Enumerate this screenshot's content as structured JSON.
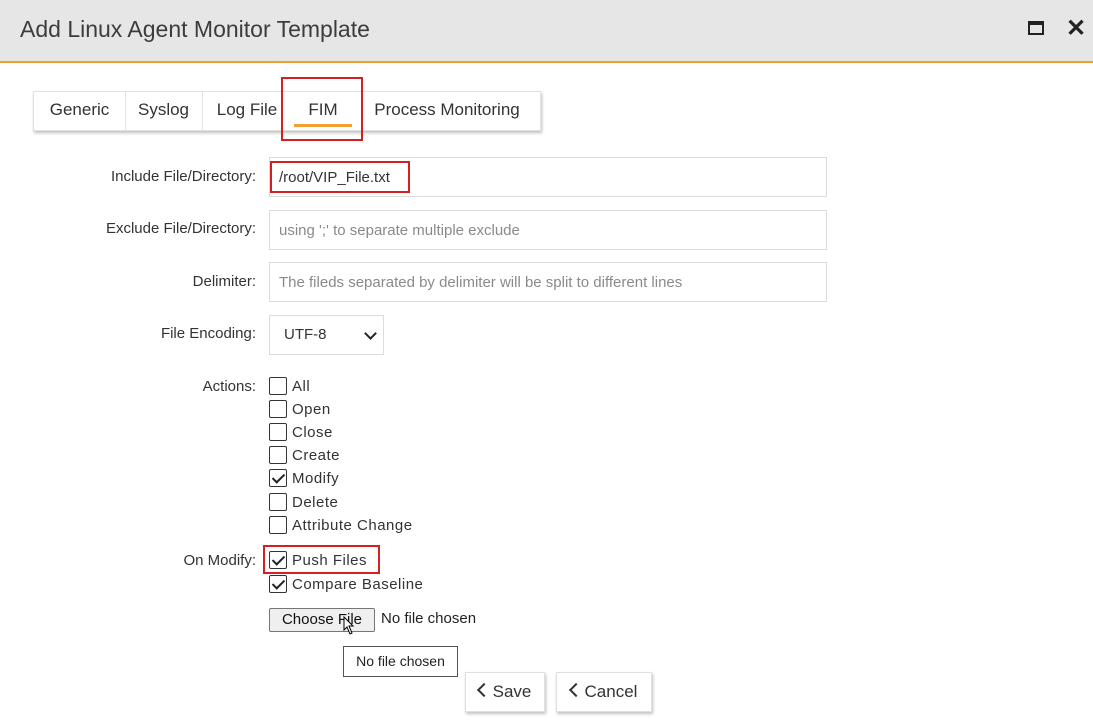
{
  "window": {
    "title": "Add Linux Agent Monitor Template",
    "maximize_icon": "maximize-icon",
    "close_icon": "close-icon",
    "close_glyph": "✕"
  },
  "tabs": [
    {
      "label": "Generic"
    },
    {
      "label": "Syslog"
    },
    {
      "label": "Log File"
    },
    {
      "label": "FIM",
      "active": true
    },
    {
      "label": "Process Monitoring"
    }
  ],
  "form": {
    "include_label": "Include File/Directory:",
    "include_value": "/root/VIP_File.txt",
    "exclude_label": "Exclude File/Directory:",
    "exclude_placeholder": "using ';' to separate multiple exclude",
    "delimiter_label": "Delimiter:",
    "delimiter_placeholder": "The fileds separated by delimiter will be split to different lines",
    "encoding_label": "File Encoding:",
    "encoding_value": "UTF-8",
    "actions_label": "Actions:",
    "actions": [
      {
        "label": "All",
        "checked": false
      },
      {
        "label": "Open",
        "checked": false
      },
      {
        "label": "Close",
        "checked": false
      },
      {
        "label": "Create",
        "checked": false
      },
      {
        "label": "Modify",
        "checked": true
      },
      {
        "label": "Delete",
        "checked": false
      },
      {
        "label": "Attribute Change",
        "checked": false
      }
    ],
    "on_modify_label": "On Modify:",
    "on_modify": [
      {
        "label": "Push Files",
        "checked": true
      },
      {
        "label": "Compare Baseline",
        "checked": true
      }
    ],
    "choose_file_label": "Choose File",
    "file_status": "No file chosen",
    "tooltip": "No file chosen"
  },
  "buttons": {
    "save": "Save",
    "cancel": "Cancel"
  },
  "colors": {
    "accent": "#f0a030",
    "highlight": "#d42020",
    "titlebar": "#e6e6e6"
  }
}
